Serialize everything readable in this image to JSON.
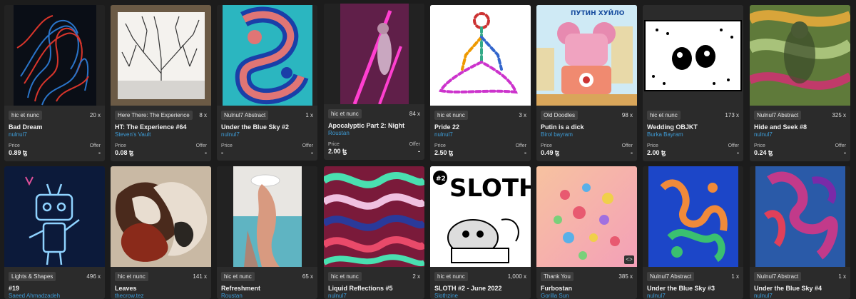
{
  "cards": [
    {
      "collection": "hic et nunc",
      "editions": "20 x",
      "title": "Bad Dream",
      "artist": "nulnul7",
      "price_label": "Price",
      "offer_label": "Offer",
      "price": "0.89 ꜩ",
      "offer": "-"
    },
    {
      "collection": "Here There: The Experience",
      "editions": "8 x",
      "title": "HT: The Experience #64",
      "artist": "Steven's Vault",
      "price_label": "Price",
      "offer_label": "Offer",
      "price": "0.08 ꜩ",
      "offer": "-"
    },
    {
      "collection": "Nulnul7 Abstract",
      "editions": "1 x",
      "title": "Under the Blue Sky #2",
      "artist": "nulnul7",
      "price_label": "Price",
      "offer_label": "Offer",
      "price": "-",
      "offer": "-"
    },
    {
      "collection": "hic et nunc",
      "editions": "84 x",
      "title": "Apocalyptic Part 2: Night",
      "artist": "Roustan",
      "price_label": "Price",
      "offer_label": "Offer",
      "price": "2.00 ꜩ",
      "offer": "-"
    },
    {
      "collection": "hic et nunc",
      "editions": "3 x",
      "title": "Pride 22",
      "artist": "nulnul7",
      "price_label": "Price",
      "offer_label": "Offer",
      "price": "2.50 ꜩ",
      "offer": "-"
    },
    {
      "collection": "Old Doodles",
      "editions": "98 x",
      "title": "Putin is a dick",
      "artist": "Birol bayram",
      "price_label": "Price",
      "offer_label": "Offer",
      "price": "0.49 ꜩ",
      "offer": "-"
    },
    {
      "collection": "hic et nunc",
      "editions": "173 x",
      "title": "Wedding OBJKT",
      "artist": "Burka Bayram",
      "price_label": "Price",
      "offer_label": "Offer",
      "price": "2.00 ꜩ",
      "offer": "-"
    },
    {
      "collection": "Nulnul7 Abstract",
      "editions": "325 x",
      "title": "Hide and Seek #8",
      "artist": "nulnul7",
      "price_label": "Price",
      "offer_label": "Offer",
      "price": "0.24 ꜩ",
      "offer": "-"
    },
    {
      "collection": "Lights & Shapes",
      "editions": "496 x",
      "title": "#19",
      "artist": "Saeed Ahmadzadeh"
    },
    {
      "collection": "hic et nunc",
      "editions": "141 x",
      "title": "Leaves",
      "artist": "thecrow.tez"
    },
    {
      "collection": "hic et nunc",
      "editions": "65 x",
      "title": "Refreshment",
      "artist": "Roustan"
    },
    {
      "collection": "hic et nunc",
      "editions": "2 x",
      "title": "Liquid Reflections #5",
      "artist": "nulnul7"
    },
    {
      "collection": "hic et nunc",
      "editions": "1,000 x",
      "title": "SLOTH #2 - June 2022",
      "artist": "Slothzine"
    },
    {
      "collection": "Thank You",
      "editions": "385 x",
      "title": "Furbostan",
      "artist": "Gorilla Sun"
    },
    {
      "collection": "Nulnul7 Abstract",
      "editions": "1 x",
      "title": "Under the Blue Sky #3",
      "artist": "nulnul7"
    },
    {
      "collection": "Nulnul7 Abstract",
      "editions": "1 x",
      "title": "Under the Blue Sky #4",
      "artist": "nulnul7"
    }
  ],
  "artwork_text": {
    "putin_banner": "ПУТИН ХУЙЛО",
    "sloth_title": "SLOTH",
    "sloth_issue": "#2"
  }
}
